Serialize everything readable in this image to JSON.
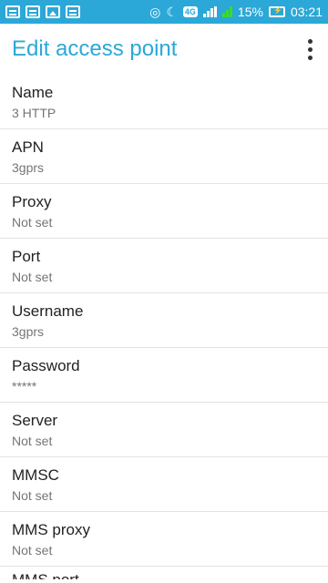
{
  "status_bar": {
    "network_label": "4G",
    "battery": "15%",
    "time": "03:21",
    "background_color": "#2ba8d7",
    "signal_accent_color": "#3ddc2b"
  },
  "app_bar": {
    "title": "Edit access point",
    "overflow_icon": "more-vert-icon",
    "title_color": "#2ba8d7"
  },
  "settings": {
    "name": {
      "title": "Name",
      "value": "3 HTTP"
    },
    "apn": {
      "title": "APN",
      "value": "3gprs"
    },
    "proxy": {
      "title": "Proxy",
      "value": "Not set"
    },
    "port": {
      "title": "Port",
      "value": "Not set"
    },
    "username": {
      "title": "Username",
      "value": "3gprs"
    },
    "password": {
      "title": "Password",
      "value": "*****"
    },
    "server": {
      "title": "Server",
      "value": "Not set"
    },
    "mmsc": {
      "title": "MMSC",
      "value": "Not set"
    },
    "mms_proxy": {
      "title": "MMS proxy",
      "value": "Not set"
    },
    "mms_port": {
      "title": "MMS port"
    }
  }
}
